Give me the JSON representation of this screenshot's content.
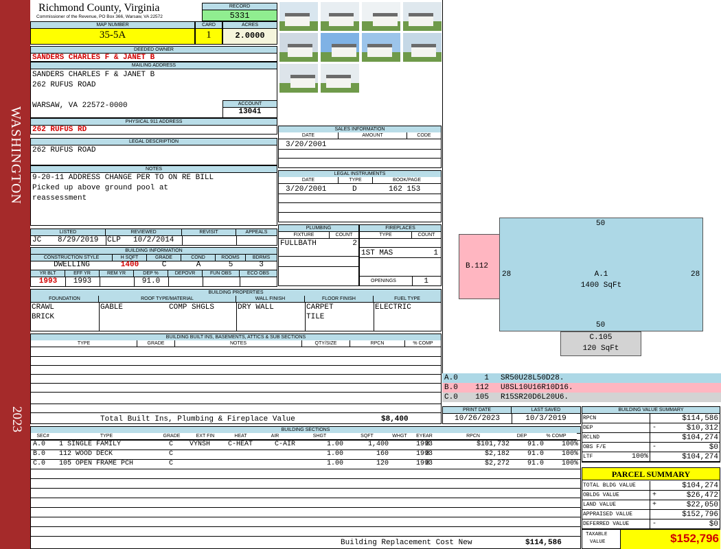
{
  "side_banner": {
    "district": "WASHINGTON",
    "year": "2023",
    "color": "#a52a2a"
  },
  "header": {
    "county": "Richmond County, Virginia",
    "commissioner": "Commissioner of the Revenue, PO Box 366, Warsaw, VA 22572"
  },
  "record": {
    "label": "RECORD",
    "value": "5331"
  },
  "map_number": {
    "label": "MAP NUMBER",
    "value": "35-5A"
  },
  "card": {
    "label": "CARD",
    "value": "1"
  },
  "acres": {
    "label": "ACRES",
    "value": "2.0000"
  },
  "deeded_owner": {
    "label": "DEEDED OWNER",
    "value": "SANDERS CHARLES F & JANET B"
  },
  "mailing_address": {
    "label": "MAILING ADDRESS",
    "line1": "SANDERS CHARLES F & JANET B",
    "line2": "262 RUFUS ROAD",
    "line3": "WARSAW, VA 22572-0000"
  },
  "account": {
    "label": "ACCOUNT",
    "value": "13041"
  },
  "physical_address": {
    "label": "PHYSICAL 911 ADDRESS",
    "value": "262 RUFUS RD"
  },
  "legal_description": {
    "label": "LEGAL DESCRIPTION",
    "value": "262 RUFUS ROAD"
  },
  "notes": {
    "label": "NOTES",
    "line1": "9-20-11 ADDRESS CHANGE PER TO ON RE BILL",
    "line2": "Picked up above ground pool at",
    "line3": "reassessment"
  },
  "review": {
    "listed_label": "LISTED",
    "reviewed_label": "REVIEWED",
    "revisit_label": "REVISIT",
    "appeals_label": "APPEALS",
    "listed_by": "JC",
    "listed_date": "8/29/2019",
    "reviewed_by": "CLP",
    "reviewed_date": "10/2/2014"
  },
  "building_info": {
    "label": "BUILDING INFORMATION",
    "headers": [
      "CONSTRUCTION STYLE",
      "H SQFT",
      "GRADE",
      "COND",
      "ROOMS",
      "BDRMS"
    ],
    "style": "DWELLING",
    "hsqft": "1400",
    "grade": "C",
    "cond": "A",
    "rooms": "5",
    "bdrms": "3",
    "headers2": [
      "YR BLT",
      "EFF YR",
      "REM YR",
      "DEP %",
      "DEPOVR",
      "FUN OBS",
      "ECO OBS"
    ],
    "yr_blt": "1993",
    "eff_yr": "1993",
    "dep": "91.0"
  },
  "sales": {
    "label": "SALES INFORMATION",
    "date_h": "DATE",
    "amount_h": "AMOUNT",
    "code_h": "CODE",
    "date": "3/20/2001"
  },
  "legal_instruments": {
    "label": "LEGAL INSTRUMENTS",
    "date_h": "DATE",
    "type_h": "TYPE",
    "book_h": "BOOK/PAGE",
    "date": "3/20/2001",
    "type": "D",
    "book": "162 153"
  },
  "plumbing": {
    "label": "PLUMBING",
    "fixture_h": "FIXTURE",
    "count_h": "COUNT",
    "fixture": "FULLBATH",
    "count": "2"
  },
  "fireplaces": {
    "label": "FIREPLACES",
    "type_h": "TYPE",
    "count_h": "COUNT",
    "type": "1ST MAS",
    "count": "1",
    "openings_label": "OPENINGS",
    "openings": "1"
  },
  "building_properties": {
    "label": "BUILDING PROPERTIES",
    "foundation_h": "FOUNDATION",
    "roof_h": "ROOF TYPE/MATERIAL",
    "wall_h": "WALL FINISH",
    "floor_h": "FLOOR FINISH",
    "fuel_h": "FUEL TYPE",
    "foundation1": "CRAWL",
    "foundation2": "BRICK",
    "roof_type": "GABLE",
    "roof_material": "COMP SHGLS",
    "wall": "DRY WALL",
    "floor1": "CARPET",
    "floor2": "TILE",
    "fuel": "ELECTRIC"
  },
  "built_ins": {
    "label": "BUILDING BUILT INS, BASEMENTS, ATTICS & SUB SECTIONS",
    "headers": [
      "TYPE",
      "GRADE",
      "NOTES",
      "QTY/SIZE",
      "RPCN",
      "% COMP"
    ],
    "total_label": "Total Built Ins, Plumbing & Fireplace Value",
    "total_value": "$8,400"
  },
  "print_info": {
    "print_label": "PRINT DATE",
    "print_date": "10/26/2023",
    "saved_label": "LAST SAVED",
    "saved_date": "10/3/2019"
  },
  "sketch": {
    "main": {
      "name": "A.1",
      "area": "1400 SqFt",
      "top": "50",
      "bottom": "50",
      "left": "28",
      "right": "28",
      "color": "#add8e6"
    },
    "deck": {
      "name": "B.112",
      "color": "#ffb6c1"
    },
    "porch": {
      "name": "C.105",
      "area": "120 SqFt",
      "color": "#d3d3d3"
    },
    "legend": [
      {
        "code": "A.0",
        "num": "1",
        "path": "SR50U28L50D28.",
        "color": "#add8e6"
      },
      {
        "code": "B.0",
        "num": "112",
        "path": "U8SL10U16R10D16.",
        "color": "#ffb6c1"
      },
      {
        "code": "C.0",
        "num": "105",
        "path": "R15SR20D6L20U6.",
        "color": "#d3d3d3"
      }
    ]
  },
  "building_sections": {
    "label": "BUILDING SECTIONS",
    "headers": [
      "SEC#",
      "TYPE",
      "GRADE",
      "EXT FIN",
      "HEAT",
      "AIR",
      "SHGT",
      "SQFT",
      "WHGT",
      "EYEAR",
      "RPCN",
      "DEP",
      "% COMP"
    ],
    "rows": [
      {
        "sec": "A.0",
        "type": "1 SINGLE FAMILY",
        "grade": "C",
        "ext": "VYNSH",
        "heat": "C-HEAT",
        "air": "C-AIR",
        "shgt": "1.00",
        "sqft": "1,400",
        "whgt": "8",
        "eyear": "1993",
        "rpcn": "$101,732",
        "dep": "91.0",
        "comp": "100%"
      },
      {
        "sec": "B.0",
        "type": "112 WOOD DECK",
        "grade": "C",
        "ext": "",
        "heat": "",
        "air": "",
        "shgt": "1.00",
        "sqft": "160",
        "whgt": "8",
        "eyear": "1993",
        "rpcn": "$2,182",
        "dep": "91.0",
        "comp": "100%"
      },
      {
        "sec": "C.0",
        "type": "105 OPEN FRAME PCH",
        "grade": "C",
        "ext": "",
        "heat": "",
        "air": "",
        "shgt": "1.00",
        "sqft": "120",
        "whgt": "8",
        "eyear": "1993",
        "rpcn": "$2,272",
        "dep": "91.0",
        "comp": "100%"
      }
    ],
    "replacement_label": "Building Replacement Cost New",
    "replacement_value": "$114,586"
  },
  "value_summary": {
    "label": "BUILDING VALUE SUMMARY",
    "rpcn_label": "RPCN",
    "rpcn": "$114,586",
    "dep_label": "DEP",
    "dep_sign": "-",
    "dep": "$10,312",
    "rclnd_label": "RCLND",
    "rclnd": "$104,274",
    "obs_label": "OBS F/E",
    "obs_sign": "-",
    "obs": "$0",
    "ltf_label": "LTF",
    "ltf_pct": "100%",
    "ltf": "$104,274"
  },
  "parcel_summary": {
    "label": "PARCEL SUMMARY",
    "bldg_label": "TOTAL BLDG VALUE",
    "bldg": "$104,274",
    "obldg_label": "OBLDG VALUE",
    "obldg_sign": "+",
    "obldg": "$26,472",
    "land_label": "LAND VALUE",
    "land_sign": "+",
    "land": "$22,050",
    "appraised_label": "APPRAISED VALUE",
    "appraised": "$152,796",
    "deferred_label": "DEFERRED VALUE",
    "deferred_sign": "-",
    "deferred": "$0",
    "taxable_label1": "TAXABLE",
    "taxable_label2": "VALUE",
    "taxable": "$152,796"
  }
}
